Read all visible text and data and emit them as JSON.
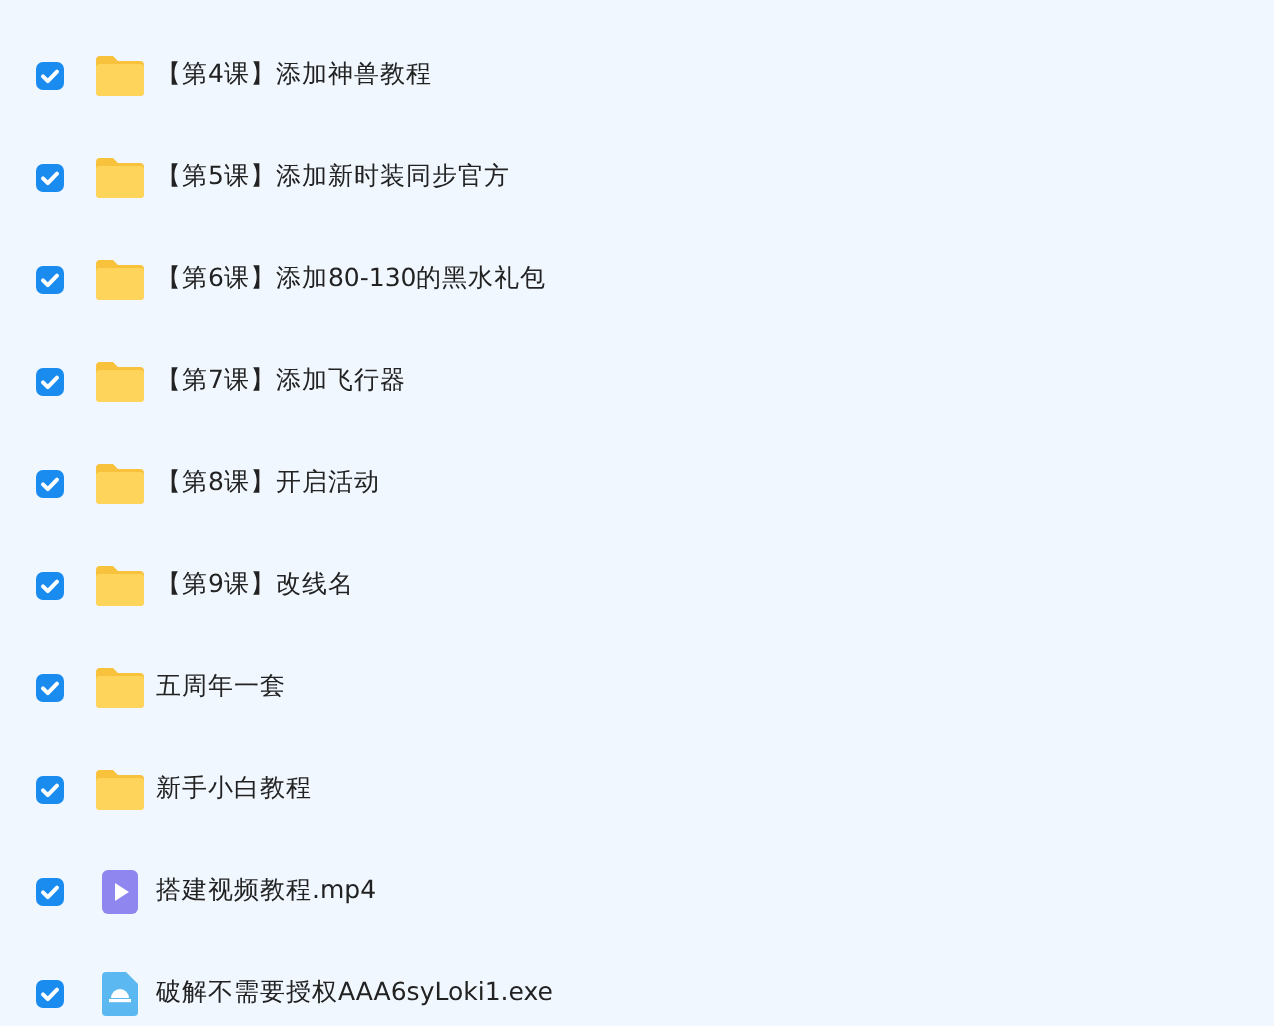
{
  "files": [
    {
      "name": "【第4课】添加神兽教程",
      "kind": "folder",
      "checked": true
    },
    {
      "name": "【第5课】添加新时装同步官方",
      "kind": "folder",
      "checked": true
    },
    {
      "name": "【第6课】添加80-130的黑水礼包",
      "kind": "folder",
      "checked": true
    },
    {
      "name": "【第7课】添加飞行器",
      "kind": "folder",
      "checked": true
    },
    {
      "name": "【第8课】开启活动",
      "kind": "folder",
      "checked": true
    },
    {
      "name": "【第9课】改线名",
      "kind": "folder",
      "checked": true
    },
    {
      "name": "五周年一套",
      "kind": "folder",
      "checked": true
    },
    {
      "name": "新手小白教程",
      "kind": "folder",
      "checked": true
    },
    {
      "name": "搭建视频教程.mp4",
      "kind": "video",
      "checked": true
    },
    {
      "name": "破解不需要授权AAA6syLoki1.exe",
      "kind": "exe",
      "checked": true
    }
  ]
}
